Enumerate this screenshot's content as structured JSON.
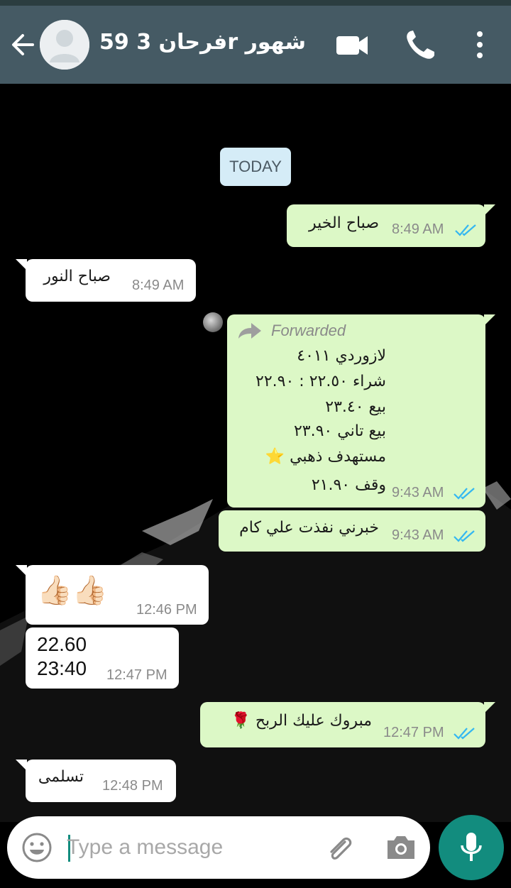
{
  "header": {
    "contact_name": "فرحان 3 59r شهور",
    "back_icon": "arrow-left-icon",
    "video_icon": "video-call-icon",
    "call_icon": "phone-icon",
    "menu_icon": "more-vertical-icon",
    "color": "#455a64"
  },
  "chat": {
    "day_label": "TODAY",
    "messages": [
      {
        "dir": "out",
        "text": "صباح الخير",
        "time": "8:49 AM",
        "status": "read"
      },
      {
        "dir": "in",
        "text": "صباح النور",
        "time": "8:49 AM"
      },
      {
        "dir": "out",
        "forwarded": true,
        "forwarded_label": "Forwarded",
        "lines": [
          "لازوردي ٤٠١١",
          "شراء ٢٢.٥٠ : ٢٢.٩٠",
          "بيع ٢٣.٤٠",
          "بيع تاني ٢٣.٩٠",
          "مستهدف ذهبي ⭐",
          "وقف ٢١.٩٠"
        ],
        "time": "9:43 AM",
        "status": "read"
      },
      {
        "dir": "out",
        "text": "خبرني نفذت علي كام",
        "time": "9:43 AM",
        "status": "read"
      },
      {
        "dir": "in",
        "text": "👍🏻👍🏻",
        "time": "12:46 PM"
      },
      {
        "dir": "in",
        "lines": [
          "22.60",
          "23:40"
        ],
        "time": "12:47 PM"
      },
      {
        "dir": "out",
        "text": "مبروك عليك الربح 🌹",
        "time": "12:47 PM",
        "status": "read"
      },
      {
        "dir": "in",
        "text": "تسلمى",
        "time": "12:48 PM"
      }
    ]
  },
  "composer": {
    "placeholder": "Type a message",
    "emoji_icon": "emoji-icon",
    "attach_icon": "paperclip-icon",
    "camera_icon": "camera-icon",
    "mic_icon": "microphone-icon",
    "accent": "#128c7e"
  },
  "colors": {
    "outgoing_bubble": "#dcf8c6",
    "incoming_bubble": "#ffffff",
    "read_ticks": "#34b7f1"
  }
}
